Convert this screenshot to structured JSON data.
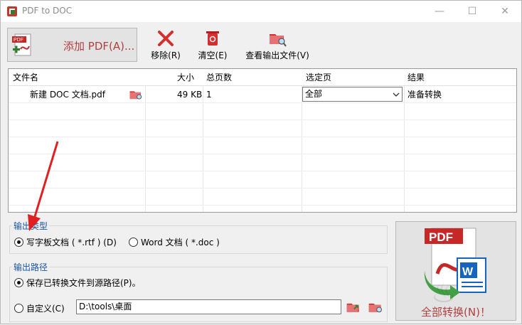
{
  "window": {
    "title": "PDF to DOC",
    "minimize": "—",
    "maximize": "☐",
    "close": "✕"
  },
  "toolbar": {
    "add_pdf": "添加 PDF(A)...",
    "remove": "移除(R)",
    "clear": "清空(E)",
    "view_output": "查看输出文件(V)"
  },
  "table": {
    "headers": [
      "文件名",
      "大小",
      "总页数",
      "选定页",
      "结果"
    ],
    "rows": [
      {
        "name": "新建 DOC 文档.pdf",
        "size": "49 KB",
        "pages": "1",
        "selected": "全部",
        "result": "准备转换"
      }
    ]
  },
  "output_type": {
    "label": "输出类型",
    "options": [
      {
        "label": "写字板文档 ( *.rtf ) (D)",
        "checked": true
      },
      {
        "label": "Word 文档 ( *.doc )",
        "checked": false
      }
    ]
  },
  "output_path": {
    "label": "输出路径",
    "source_option": "保存已转换文件到源路径(P)。",
    "custom_option": "自定义(C)",
    "custom_value": "D:\\tools\\桌面",
    "source_checked": true
  },
  "convert_button": "全部转换(N)！",
  "colors": {
    "accent_red": "#b04040",
    "group_label": "#1a55a0",
    "annotation_arrow": "#e02020"
  }
}
